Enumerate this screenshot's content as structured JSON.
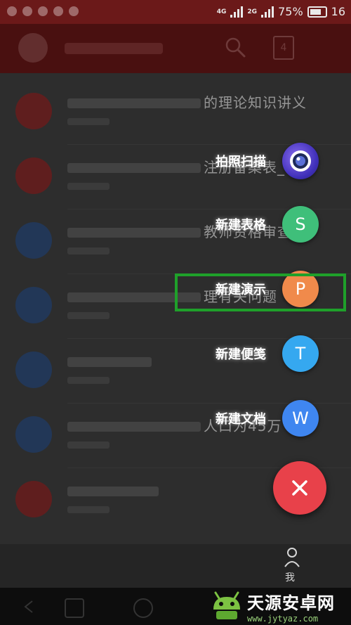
{
  "status_bar": {
    "network_1": "4G",
    "network_2": "2G",
    "battery_percent": "75%",
    "time_partial": "16"
  },
  "app_bar": {
    "tab_count": "4"
  },
  "list_peek": [
    "的理论知识讲义",
    "注册备案表_",
    "教师资格审查表",
    "理有关问题",
    "人口为45万"
  ],
  "fab_menu": {
    "items": [
      {
        "label": "拍照扫描",
        "icon": "camera-icon",
        "color": "#4a3fd8"
      },
      {
        "label": "新建表格",
        "icon": "S",
        "color": "#3fbf7a"
      },
      {
        "label": "新建演示",
        "icon": "P",
        "color": "#f08a4b"
      },
      {
        "label": "新建便笺",
        "icon": "T",
        "color": "#35a8f0"
      },
      {
        "label": "新建文档",
        "icon": "W",
        "color": "#3f86f0"
      }
    ],
    "close_icon": "close-icon",
    "close_color": "#e8414a"
  },
  "bottom_nav": {
    "me_label": "我"
  },
  "watermark": {
    "name": "天源安卓网",
    "url": "www.jytyaz.com"
  }
}
